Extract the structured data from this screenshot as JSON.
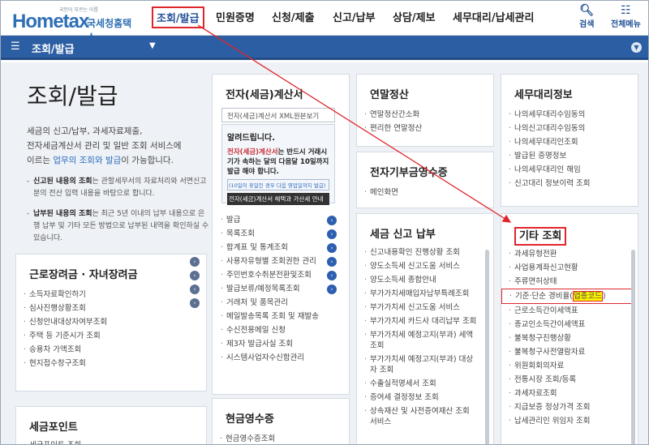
{
  "header": {
    "logo_tag": "국민이 부르는 이름",
    "logo_text": "Hometax",
    "logo_kor": "국세청홈택스",
    "nav": [
      "조회/발급",
      "민원증명",
      "신청/제출",
      "신고/납부",
      "상담/제보",
      "세무대리/납세관리"
    ],
    "search_label": "검색",
    "allmenu_label": "전체메뉴"
  },
  "subbar": {
    "title": "조회/발급"
  },
  "intro": {
    "title": "조회/발급",
    "desc1": "세금의 신고/납부, 과세자료제출,",
    "desc2": "전자세금계산서 관리 및 일반 조회 서비스에",
    "desc3_pre": "이르는 ",
    "desc3_hl": "업무의 조회와 발급",
    "desc3_post": "이 가능합니다.",
    "bullet1_b": "신고된 내용의 조회",
    "bullet1": "는 관할세무서의 자료처리와 서면신고분의 전산 입력 내용을 바탕으로 합니다.",
    "bullet2_b": "납부된 내용의 조회",
    "bullet2": "는 최근 5년 이내의 납부 내용으로 은행 납부 및 기타 모든 방법으로 납부된 내역을 확인하실 수 있습니다."
  },
  "labor": {
    "title": "근로장려금 · 자녀장려금",
    "items": [
      "소득자료확인하기",
      "심사진행상황조회",
      "신청안내대상자여부조회",
      "주택 등 기준시가 조회",
      "승용차 가액조회",
      "현지접수창구조회"
    ]
  },
  "points": {
    "title": "세금포인트",
    "items": [
      "세금포인트 조회"
    ]
  },
  "etax": {
    "title": "전자(세금)계산서",
    "xml_label": "전자(세금)계산서 XML원본보기",
    "notice_title": "알려드립니다.",
    "notice_body_1": "전자(세금)계산서",
    "notice_body_2": "는 반드시 거래시기가 속하는 달의 다음달 10일까지 발급 해야 합니다.",
    "notice_sub": "(10일이 휴일인 경우 다음 영업일까지 발급)",
    "notice_dark": "전자(세금)계산서 해택과 가산세 안내",
    "items": [
      "발급",
      "목록조회",
      "합계표 및 통계조회",
      "사용자유형별 조회권한 관리",
      "주민번호수취분전환및조회",
      "발급보류/예정목록조회",
      "거래처 및 품목관리",
      "메일발송목록 조회 및 재발송",
      "수신전용메일 신청",
      "제3자 발급사실 조회",
      "시스템사업자수신함관리"
    ]
  },
  "cashreceipt": {
    "title": "현금영수증",
    "items": [
      "현금영수증조회"
    ]
  },
  "yearend": {
    "title": "연말정산",
    "items": [
      "연말정산간소화",
      "편리한 연말정산"
    ]
  },
  "donation": {
    "title": "전자기부금영수증",
    "items": [
      "메인화면"
    ]
  },
  "taxpay": {
    "title": "세금 신고 납부",
    "items": [
      "신고내용확인 진행상황 조회",
      "양도소득세 신고도움 서비스",
      "양도소득세 종합안내",
      "부가가치세매입자납부특례조회",
      "부가가치세 신고도움 서비스",
      "부가가치세 카드사 대리납부 조회",
      "부가가치세 예정고지(부과) 세액조회",
      "부가가치세 예정고지(부과) 대상자 조회",
      "수출실적명세서 조회",
      "증여세 결정정보 조회",
      "상속재산 및 사전증여재산 조회 서비스"
    ]
  },
  "taxagent": {
    "title": "세무대리정보",
    "items": [
      "나의세무대리수임동의",
      "나의신고대리수임동의",
      "나의세무대리인조회",
      "발급된 증명정보",
      "나의세무대리인 해임",
      "신고대리 정보이력 조회"
    ]
  },
  "other": {
    "title": "기타 조회",
    "items": [
      "과세유형전환",
      "사업용계좌신고현황",
      "주류면허상태",
      "기준·단순 경비율(",
      "근로소득간이세액표",
      "종교인소득간이세액표",
      "불복청구진행상황",
      "불복청구사전열람자료",
      "위원회회의자료",
      "전통시장 조회/등록",
      "과세자료조회",
      "지급보증 정상가격 조회",
      "납세관리인 위임자 조회"
    ],
    "highlight": "업종코드",
    "highlight_close": ")"
  },
  "colors": {
    "brand": "#2c5ea3",
    "annotation": "#e0262d",
    "highlight": "#fff200"
  }
}
